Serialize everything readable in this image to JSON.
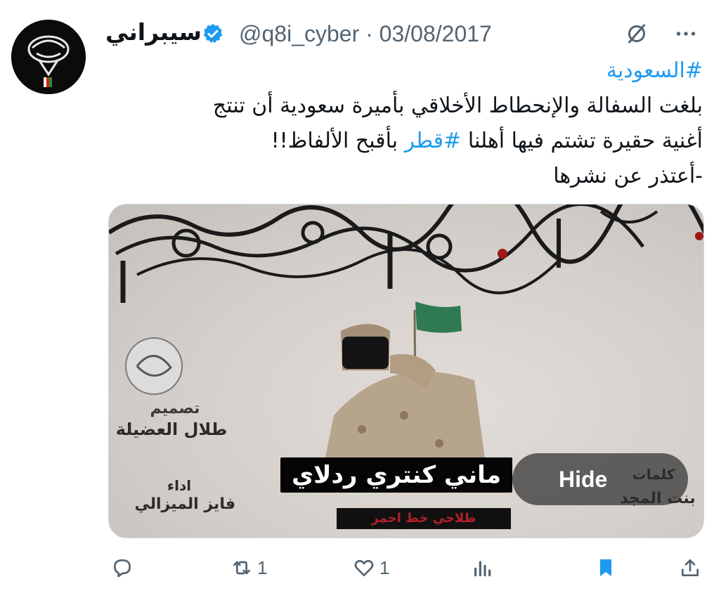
{
  "tweet": {
    "author": {
      "display_name": "سيبراني",
      "handle": "@q8i_cyber",
      "date": "03/08/2017",
      "verified": true,
      "avatar_icon": "kuwait-emblem-avatar"
    },
    "text": {
      "hashtag_line": "#السعودية",
      "line2": "بلغت السفالة والإنحطاط الأخلاقي بأميرة سعودية أن تنتج",
      "line3_before": "أغنية حقيرة تشتم فيها أهلنا ",
      "line3_hashtag": "#قطر",
      "line3_after": " بأقبح الألفاظ!!",
      "line4": "-أعتذر عن نشرها"
    },
    "media": {
      "design_title": "تصميم",
      "design_name": "طلال العضيلة",
      "performance_title": "اداء",
      "performance_name": "فايز الميزالي",
      "lyrics_title": "كلمات",
      "lyrics_name": "بنت المجد",
      "song_title": "ماني كنتري ردلاي",
      "song_subtitle": "طلاحي خط احمر",
      "hide_label": "Hide"
    },
    "actions": {
      "reply_icon": "reply-icon",
      "retweet_count": "1",
      "like_count": "1",
      "views_icon": "analytics-icon",
      "bookmark_icon": "bookmark-icon",
      "share_icon": "share-icon"
    },
    "colors": {
      "link": "#1d9bf0",
      "muted": "#536471",
      "bookmark": "#1d9bf0",
      "flag_green": "#2f7a52"
    }
  }
}
